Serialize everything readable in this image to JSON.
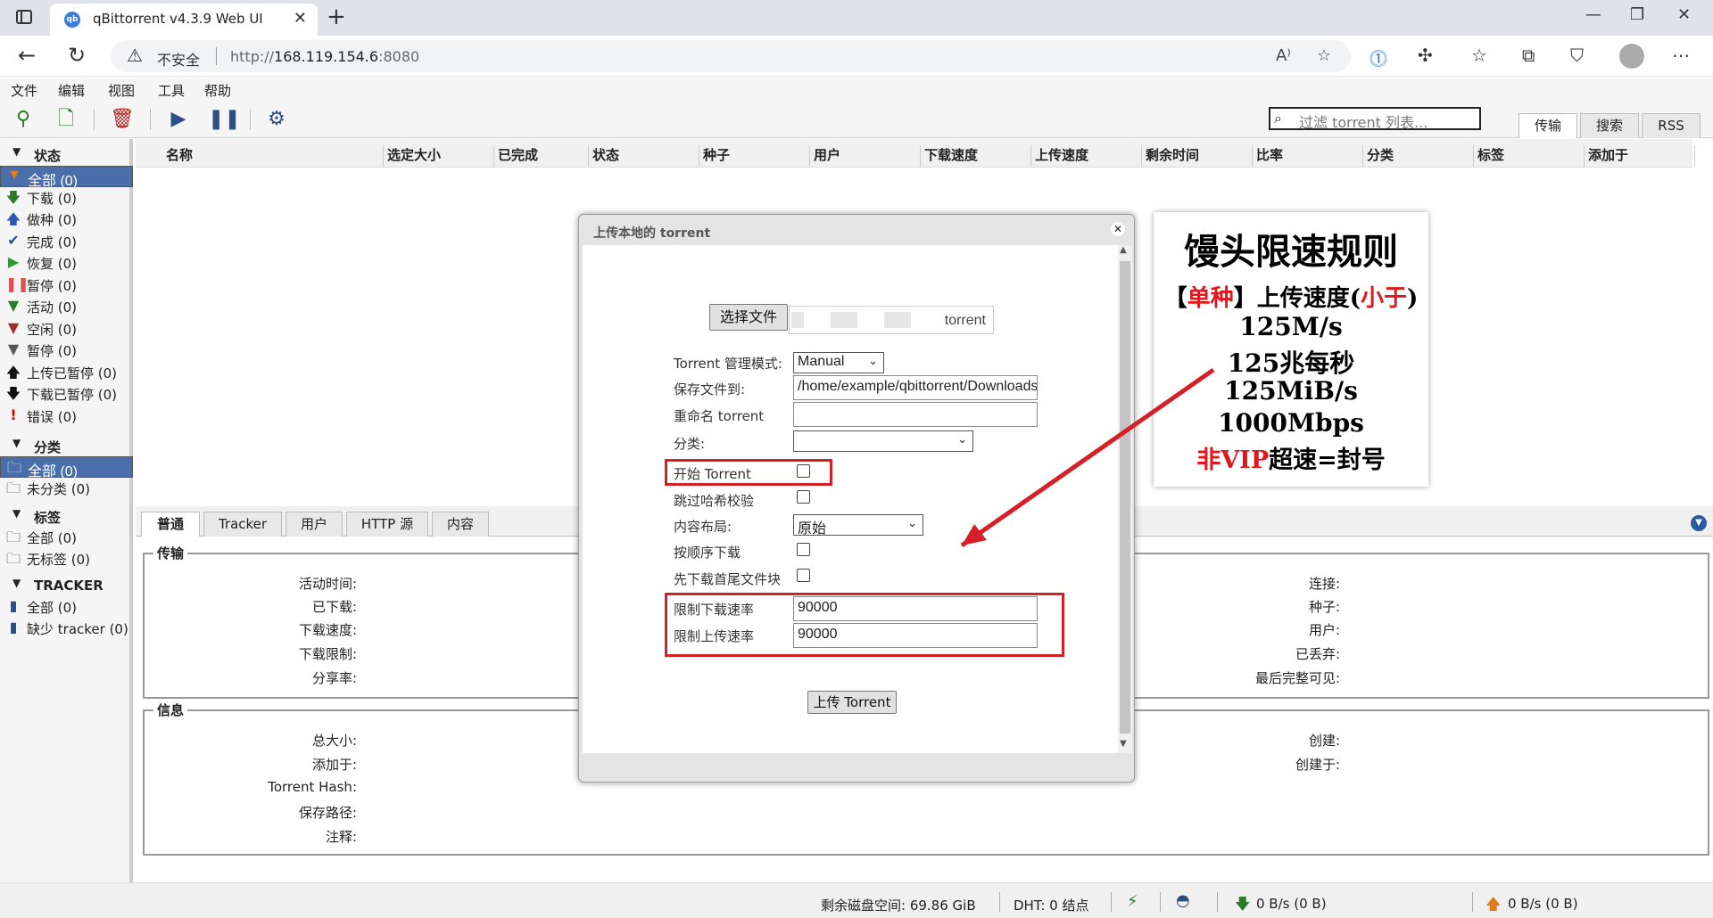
{
  "browser": {
    "tab_title": "qBittorrent v4.3.9 Web UI",
    "insecure_label": "不安全",
    "url_prefix": "http://",
    "url_host": "168.119.154.6",
    "url_port": ":8080"
  },
  "menu": [
    "文件",
    "编辑",
    "视图",
    "工具",
    "帮助"
  ],
  "toolbar": {
    "filter_placeholder": "过滤 torrent 列表...",
    "right_tabs": [
      "传输",
      "搜索",
      "RSS"
    ]
  },
  "sidebar": {
    "status_header": "状态",
    "status_items": [
      "全部 (0)",
      "下载 (0)",
      "做种 (0)",
      "完成 (0)",
      "恢复 (0)",
      "暂停 (0)",
      "活动 (0)",
      "空闲 (0)",
      "暂停 (0)",
      "上传已暂停 (0)",
      "下载已暂停 (0)",
      "错误 (0)"
    ],
    "category_header": "分类",
    "category_items": [
      "全部 (0)",
      "未分类 (0)"
    ],
    "tag_header": "标签",
    "tag_items": [
      "全部 (0)",
      "无标签 (0)"
    ],
    "tracker_header": "TRACKER",
    "tracker_items": [
      "全部 (0)",
      "缺少 tracker (0)"
    ]
  },
  "columns": [
    "名称",
    "选定大小",
    "已完成",
    "状态",
    "种子",
    "用户",
    "下载速度",
    "上传速度",
    "剩余时间",
    "比率",
    "分类",
    "标签",
    "添加于"
  ],
  "panel": {
    "tabs": [
      "普通",
      "Tracker",
      "用户",
      "HTTP 源",
      "内容"
    ],
    "transfer_legend": "传输",
    "transfer_left": [
      "活动时间:",
      "已下载:",
      "下载速度:",
      "下载限制:",
      "分享率:"
    ],
    "transfer_right": [
      "连接:",
      "种子:",
      "用户:",
      "已丢弃:",
      "最后完整可见:"
    ],
    "info_legend": "信息",
    "info_left": [
      "总大小:",
      "添加于:",
      "Torrent Hash:",
      "保存路径:",
      "注释:"
    ],
    "info_right": [
      "创建:",
      "创建于:"
    ]
  },
  "status": {
    "free_space": "剩余磁盘空间: 69.86 GiB",
    "dht": "DHT: 0 结点",
    "down": "0 B/s (0 B)",
    "up": "0 B/s (0 B)"
  },
  "dialog": {
    "title": "上传本地的 torrent",
    "choose_file": "选择文件",
    "file_suffix": "torrent",
    "mode_label": "Torrent 管理模式:",
    "mode_value": "Manual",
    "save_label": "保存文件到:",
    "save_value": "/home/example/qbittorrent/Downloads",
    "rename_label": "重命名 torrent",
    "category_label": "分类:",
    "start_label": "开始 Torrent",
    "skip_label": "跳过哈希校验",
    "layout_label": "内容布局:",
    "layout_value": "原始",
    "seq_label": "按顺序下载",
    "firstlast_label": "先下载首尾文件块",
    "dl_limit_label": "限制下载速率",
    "dl_limit_value": "90000",
    "ul_limit_label": "限制上传速率",
    "ul_limit_value": "90000",
    "upload_button": "上传 Torrent"
  },
  "annotation": {
    "title": "馒头限速规则",
    "line1_a": "【",
    "line1_b": "单种",
    "line1_c": "】上传速度(",
    "line1_d": "小于",
    "line1_e": ")",
    "line2": "125M/s",
    "line3": "125兆每秒",
    "line4": "125MiB/s",
    "line5": "1000Mbps",
    "line6_a": "非VIP",
    "line6_b": "超速=封号"
  },
  "colors": {
    "highlight_red": "#d42026",
    "selected_blue": "#4a6ea9"
  }
}
